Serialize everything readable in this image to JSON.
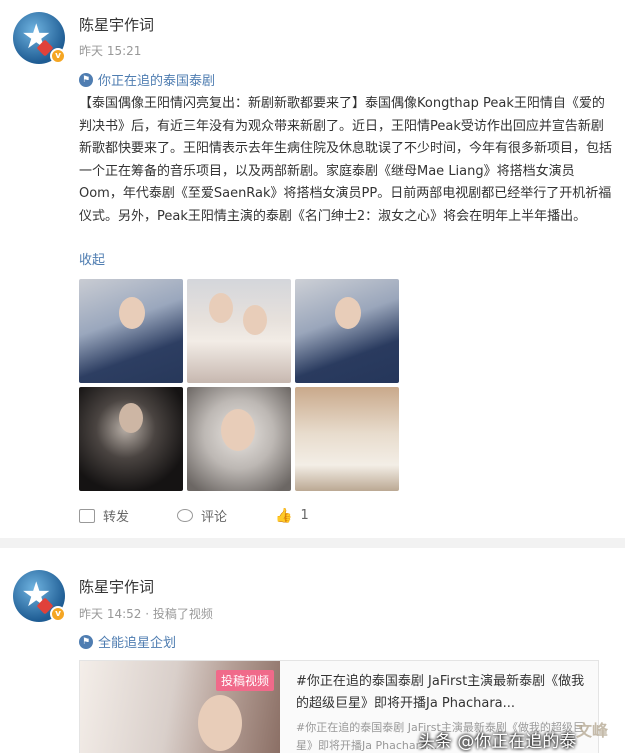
{
  "post1": {
    "username": "陈星宇作词",
    "time": "昨天 15:21",
    "topic": "你正在追的泰国泰剧",
    "text": "【泰国偶像王阳情闪亮复出：新剧新歌都要来了】泰国偶像Kongthap Peak王阳情自《爱的判决书》后，有近三年没有为观众带来新剧了。近日，王阳情Peak受访作出回应并宣告新剧新歌都快要来了。王阳情表示去年生病住院及休息耽误了不少时间，今年有很多新项目，包括一个正在筹备的音乐项目，以及两部新剧。家庭泰剧《继母Mae Liang》将搭档女演员Oom，年代泰剧《至爱SaenRak》将搭档女演员PP。日前两部电视剧都已经举行了开机祈福仪式。另外，Peak王阳情主演的泰剧《名门绅士2：淑女之心》将会在明年上半年播出。",
    "fold": "收起",
    "actions": {
      "repost": "转发",
      "comment": "评论",
      "like": "1"
    }
  },
  "post2": {
    "username": "陈星宇作词",
    "time": "昨天 14:52 · 投稿了视频",
    "topic": "全能追星企划",
    "video_badge": "投稿视频",
    "video_title": "#你正在追的泰国泰剧 JaFirst主演最新泰剧《做我的超级巨星》即将开播Ja Phachara...",
    "video_desc": "#你正在追的泰国泰剧 JaFirst主演最新泰剧《做我的超级巨星》即将开播Ja Phachara..."
  },
  "watermark": "头条 @你正在追的泰",
  "colors": {
    "link": "#4f7db1",
    "badge": "#f5a623",
    "video_badge": "#f06a8a"
  }
}
